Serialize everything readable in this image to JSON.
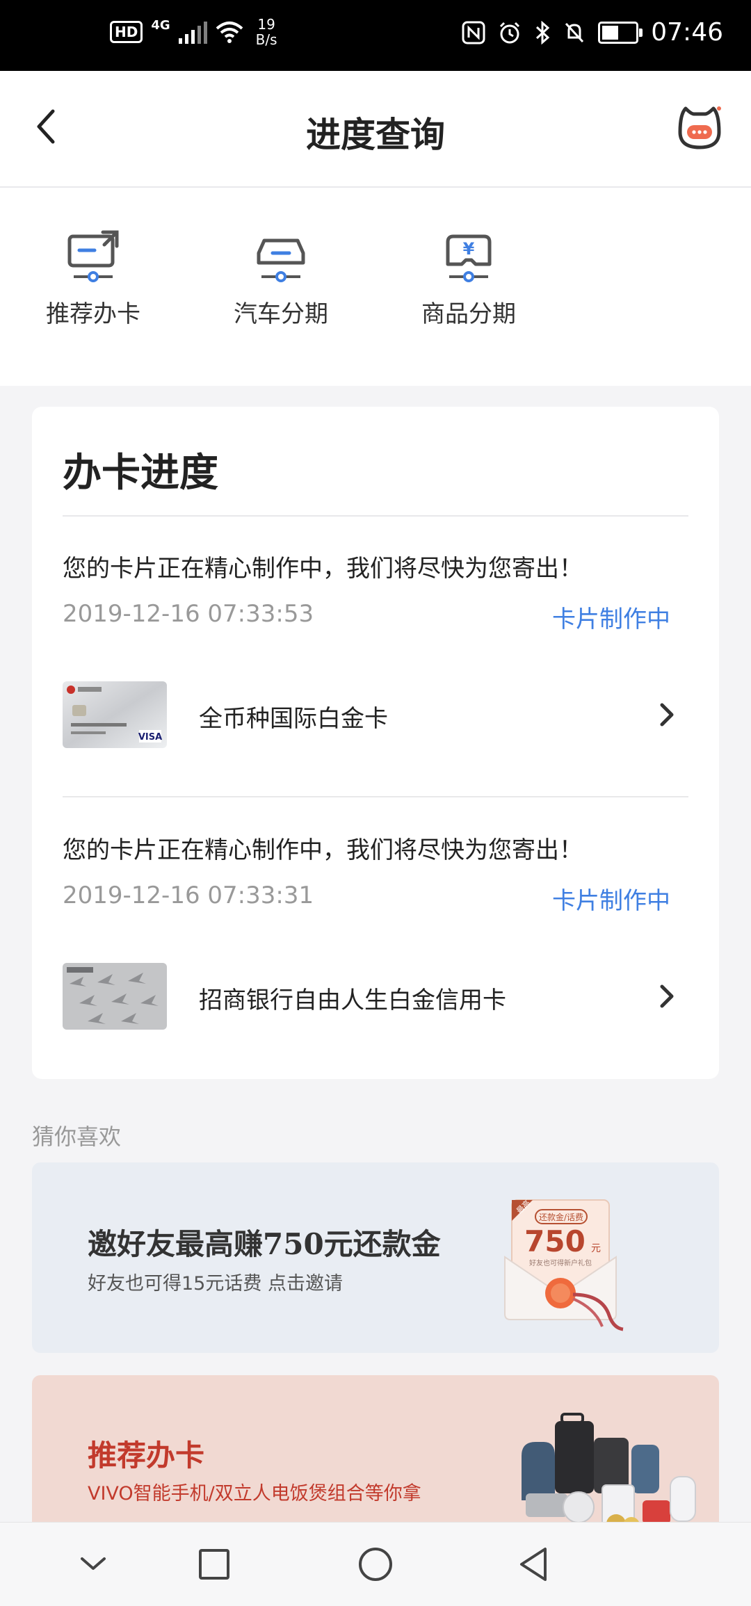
{
  "status_bar": {
    "hd": "HD",
    "network_type": "4G",
    "net_speed_value": "19",
    "net_speed_unit": "B/s",
    "time": "07:46",
    "battery_level": 0.5
  },
  "nav": {
    "title": "进度查询"
  },
  "quick": [
    {
      "label": "推荐办卡",
      "icon": "recommend-card-icon"
    },
    {
      "label": "汽车分期",
      "icon": "car-icon"
    },
    {
      "label": "商品分期",
      "icon": "goods-yen-icon"
    }
  ],
  "progress": {
    "title": "办卡进度",
    "items": [
      {
        "message": "您的卡片正在精心制作中，我们将尽快为您寄出！",
        "time": "2019-12-16 07:33:53",
        "status": "卡片制作中",
        "card_name": "全币种国际白金卡"
      },
      {
        "message": "您的卡片正在精心制作中，我们将尽快为您寄出！",
        "time": "2019-12-16 07:33:31",
        "status": "卡片制作中",
        "card_name": "招商银行自由人生白金信用卡"
      }
    ]
  },
  "guess": {
    "label": "猜你喜欢",
    "banner1": {
      "title": "邀好友最高赚750元还款金",
      "subtitle": "好友也可得15元话费  点击邀请",
      "envelope_tag": "还款金/话费",
      "envelope_amount": "750",
      "envelope_unit": "元",
      "envelope_corner": "最高",
      "envelope_note": "好友也可得新户礼包"
    },
    "banner2": {
      "title": "推荐办卡",
      "subtitle": "VIVO智能手机/双立人电饭煲组合等你拿"
    }
  },
  "colors": {
    "accent": "#3f7fe2",
    "primary_text": "#222222",
    "secondary_text": "#999999"
  }
}
